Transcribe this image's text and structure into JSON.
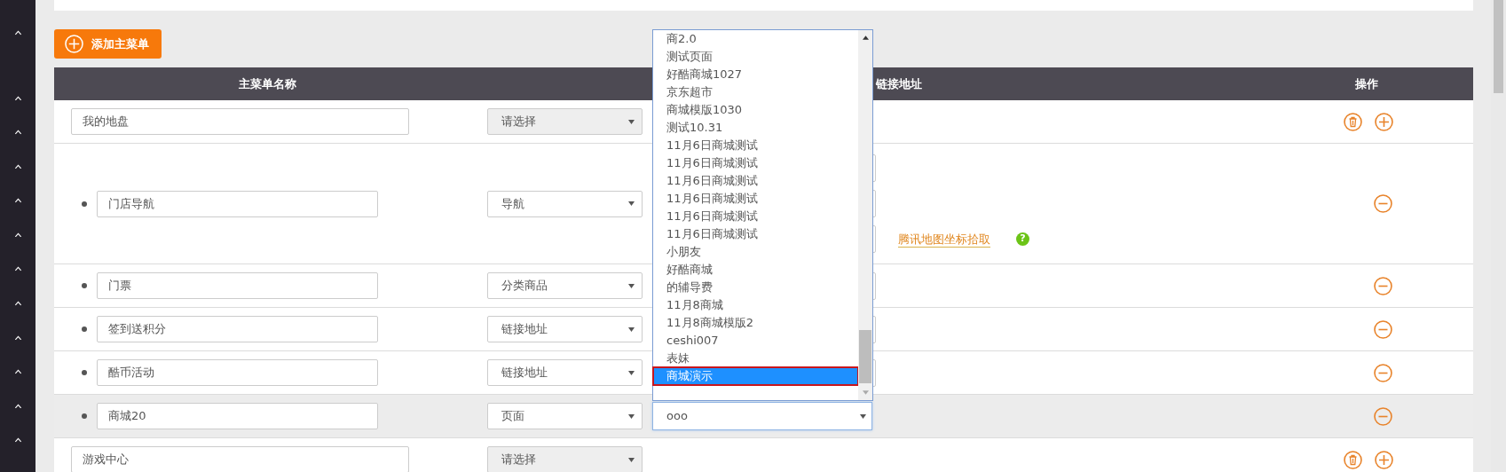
{
  "add_button": {
    "label": "添加主菜单"
  },
  "table": {
    "columns": [
      {
        "label": "主菜单名称"
      },
      {
        "label": "链接地址"
      },
      {
        "label": "操作"
      }
    ],
    "rows": [
      {
        "kind": "menu",
        "name": "我的地盘",
        "type": {
          "value": "请选择",
          "disabled": true
        },
        "highlighted": false,
        "fields": []
      },
      {
        "kind": "submenu",
        "name": "门店导航",
        "type": {
          "value": "导航",
          "disabled": false
        },
        "highlighted": false,
        "fields": [
          {
            "kind": "text"
          },
          {
            "kind": "text"
          },
          {
            "kind": "text",
            "link": "腾讯地图坐标拾取",
            "help": "?"
          }
        ]
      },
      {
        "kind": "submenu",
        "name": "门票",
        "type": {
          "value": "分类商品",
          "disabled": false
        },
        "highlighted": false,
        "fields": [
          {
            "kind": "text"
          }
        ]
      },
      {
        "kind": "submenu",
        "name": "签到送积分",
        "type": {
          "value": "链接地址",
          "disabled": false
        },
        "highlighted": false,
        "fields": [
          {
            "kind": "text"
          }
        ]
      },
      {
        "kind": "submenu",
        "name": "酷币活动",
        "type": {
          "value": "链接地址",
          "disabled": false
        },
        "highlighted": false,
        "fields": [
          {
            "kind": "text"
          }
        ]
      },
      {
        "kind": "submenu",
        "name": "商城20",
        "type": {
          "value": "页面",
          "disabled": false
        },
        "highlighted": true,
        "fields": [
          {
            "kind": "select",
            "value": "ooo",
            "expanded": true,
            "options": [
              {
                "label": "商2.0",
                "selected": false,
                "marked": false
              },
              {
                "label": "测试页面",
                "selected": false,
                "marked": false
              },
              {
                "label": "好酷商城1027",
                "selected": false,
                "marked": false
              },
              {
                "label": "京东超市",
                "selected": false,
                "marked": false
              },
              {
                "label": "商城模版1030",
                "selected": false,
                "marked": false
              },
              {
                "label": "测试10.31",
                "selected": false,
                "marked": false
              },
              {
                "label": "11月6日商城测试",
                "selected": false,
                "marked": false
              },
              {
                "label": "11月6日商城测试",
                "selected": false,
                "marked": false
              },
              {
                "label": "11月6日商城测试",
                "selected": false,
                "marked": false
              },
              {
                "label": "11月6日商城测试",
                "selected": false,
                "marked": false
              },
              {
                "label": "11月6日商城测试",
                "selected": false,
                "marked": false
              },
              {
                "label": "11月6日商城测试",
                "selected": false,
                "marked": false
              },
              {
                "label": "小朋友",
                "selected": false,
                "marked": false
              },
              {
                "label": "好酷商城",
                "selected": false,
                "marked": false
              },
              {
                "label": "的辅导费",
                "selected": false,
                "marked": false
              },
              {
                "label": "11月8商城",
                "selected": false,
                "marked": false
              },
              {
                "label": "11月8商城模版2",
                "selected": false,
                "marked": false
              },
              {
                "label": "ceshi007",
                "selected": false,
                "marked": false
              },
              {
                "label": "表妹",
                "selected": false,
                "marked": false
              },
              {
                "label": "商城演示",
                "selected": true,
                "marked": true
              }
            ]
          }
        ]
      },
      {
        "kind": "menu",
        "name": "游戏中心",
        "type": {
          "value": "请选择",
          "disabled": true
        },
        "highlighted": false,
        "fields": []
      }
    ]
  }
}
